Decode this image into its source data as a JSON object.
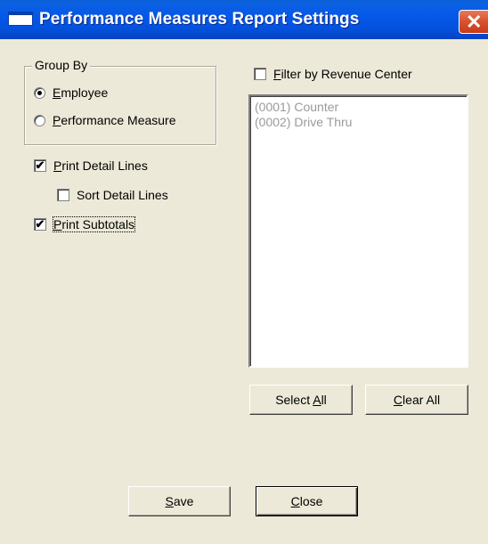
{
  "window": {
    "title": "Performance Measures Report Settings"
  },
  "group_by": {
    "label": "Group By",
    "options": [
      {
        "first": "E",
        "rest": "mployee",
        "selected": true
      },
      {
        "first": "P",
        "rest": "erformance Measure",
        "selected": false
      }
    ]
  },
  "options": {
    "print_detail_lines": {
      "first": "P",
      "rest": "rint Detail Lines",
      "checked": true
    },
    "sort_detail_lines": {
      "label": "Sort Detail Lines",
      "checked": false
    },
    "print_subtotals": {
      "first": "P",
      "rest": "rint Subtotals",
      "checked": true
    }
  },
  "filter": {
    "first": "F",
    "rest": "ilter by Revenue Center",
    "checked": false
  },
  "revenue_centers": [
    "(0001) Counter",
    "(0002) Drive Thru"
  ],
  "buttons": {
    "select_all": {
      "pre": "Select ",
      "u": "A",
      "post": "ll"
    },
    "clear_all": {
      "pre": "",
      "u": "C",
      "post": "lear All"
    },
    "save": {
      "pre": "",
      "u": "S",
      "post": "ave"
    },
    "close": {
      "pre": "",
      "u": "C",
      "post": "lose"
    }
  },
  "check_mark": "✔",
  "icons": {
    "close": "close-icon",
    "app": "window-icon"
  },
  "colors": {
    "titlebar": "#0558ea",
    "dialog_bg": "#ece9d8",
    "disabled_text": "#9a9a9a",
    "close_button": "#d9552f"
  }
}
